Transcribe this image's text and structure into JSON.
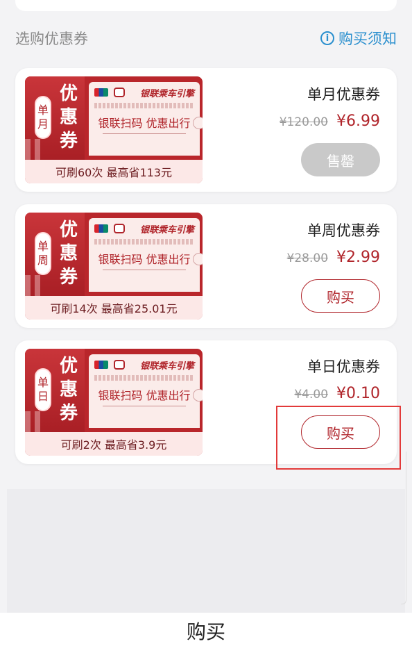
{
  "header": {
    "section_title": "选购优惠券",
    "notice_link": "购买须知",
    "info_glyph": "i"
  },
  "coupons": [
    {
      "name": "单月优惠券",
      "original_price": "¥120.00",
      "price": "¥6.99",
      "button": "售罄",
      "button_state": "sold-out",
      "art": {
        "badge": [
          "单",
          "月"
        ],
        "big": [
          "优",
          "惠",
          "券"
        ],
        "brand": "银联乘车引擎",
        "slogan": "银联扫码 优惠出行",
        "caption": "可刷60次 最高省113元"
      }
    },
    {
      "name": "单周优惠券",
      "original_price": "¥28.00",
      "price": "¥2.99",
      "button": "购买",
      "button_state": "available",
      "art": {
        "badge": [
          "单",
          "周"
        ],
        "big": [
          "优",
          "惠",
          "券"
        ],
        "brand": "银联乘车引擎",
        "slogan": "银联扫码 优惠出行",
        "caption": "可刷14次 最高省25.01元"
      }
    },
    {
      "name": "单日优惠券",
      "original_price": "¥4.00",
      "price": "¥0.10",
      "button": "购买",
      "button_state": "available",
      "art": {
        "badge": [
          "单",
          "日"
        ],
        "big": [
          "优",
          "惠",
          "券"
        ],
        "brand": "银联乘车引擎",
        "slogan": "银联扫码 优惠出行",
        "caption": "可刷2次 最高省3.9元"
      }
    }
  ],
  "footer_caption": "购买",
  "colors": {
    "accent_red": "#b0242a",
    "link_blue": "#2a8fce",
    "sold_gray": "#c9c9c9",
    "highlight_red": "#e23a3a"
  }
}
